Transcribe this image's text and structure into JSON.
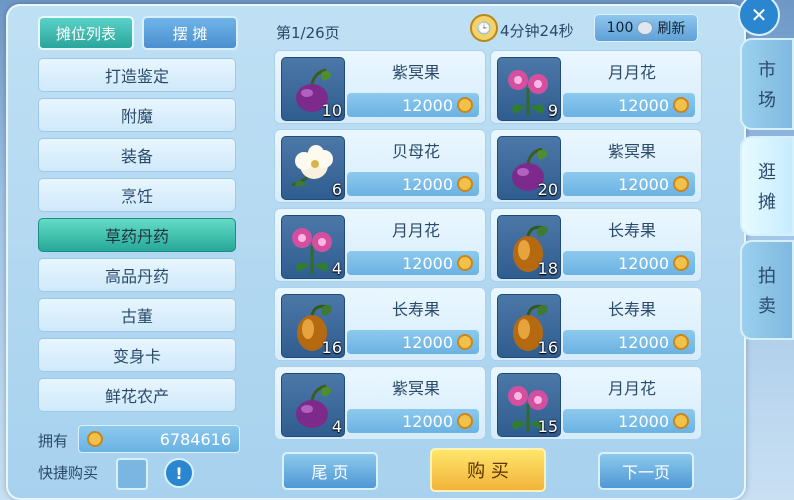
{
  "tabs": {
    "list_label": "摊位列表",
    "stall_label": "摆 摊"
  },
  "categories": [
    "打造鉴定",
    "附魔",
    "装备",
    "烹饪",
    "草药丹药",
    "高品丹药",
    "古董",
    "变身卡",
    "鲜花农产"
  ],
  "active_category": "草药丹药",
  "pagination": {
    "label": "第1/26页"
  },
  "timer": {
    "label": "4分钟24秒"
  },
  "refresh": {
    "cost": "100",
    "label": "刷新"
  },
  "items": [
    {
      "name": "紫冥果",
      "qty": "10",
      "price": "12000",
      "icon": "purple-plum-icon"
    },
    {
      "name": "月月花",
      "qty": "9",
      "price": "12000",
      "icon": "pink-flower-icon"
    },
    {
      "name": "贝母花",
      "qty": "6",
      "price": "12000",
      "icon": "white-flower-icon"
    },
    {
      "name": "紫冥果",
      "qty": "20",
      "price": "12000",
      "icon": "purple-plum-icon"
    },
    {
      "name": "月月花",
      "qty": "4",
      "price": "12000",
      "icon": "pink-flower-icon"
    },
    {
      "name": "长寿果",
      "qty": "18",
      "price": "12000",
      "icon": "golden-fruit-icon"
    },
    {
      "name": "长寿果",
      "qty": "16",
      "price": "12000",
      "icon": "golden-fruit-icon"
    },
    {
      "name": "长寿果",
      "qty": "16",
      "price": "12000",
      "icon": "golden-fruit-icon"
    },
    {
      "name": "紫冥果",
      "qty": "4",
      "price": "12000",
      "icon": "purple-plum-icon"
    },
    {
      "name": "月月花",
      "qty": "15",
      "price": "12000",
      "icon": "pink-flower-icon"
    }
  ],
  "balance": {
    "label": "拥有",
    "value": "6784616"
  },
  "quick_buy": {
    "label": "快捷购买"
  },
  "buttons": {
    "last_page": "尾 页",
    "buy": "购 买",
    "next_page": "下一页"
  },
  "side_tabs": {
    "market": [
      "市",
      "场"
    ],
    "stall": [
      "逛",
      "摊"
    ],
    "auction": [
      "拍",
      "卖"
    ]
  },
  "colors": {
    "accent": "#27a899",
    "gold": "#f2b23a",
    "text": "#2b4a6a"
  }
}
